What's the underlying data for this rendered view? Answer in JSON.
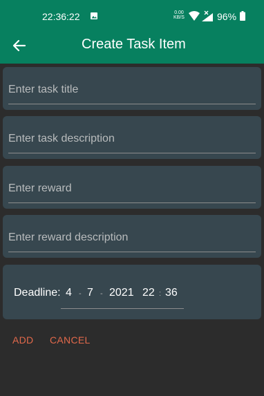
{
  "status_bar": {
    "time": "22:36:22",
    "speed_value": "0.00",
    "speed_unit": "KB/S",
    "battery": "96%"
  },
  "app_bar": {
    "title": "Create Task Item",
    "back_icon": "arrow-left-icon"
  },
  "form": {
    "title_placeholder": "Enter task title",
    "description_placeholder": "Enter task description",
    "reward_placeholder": "Enter reward",
    "reward_description_placeholder": "Enter reward description"
  },
  "deadline": {
    "label": "Deadline:",
    "day": "4",
    "month": "7",
    "year": "2021",
    "hour": "22",
    "minute": "36",
    "date_separator": "-",
    "time_separator": ":"
  },
  "actions": {
    "add_label": "ADD",
    "cancel_label": "CANCEL"
  },
  "colors": {
    "app_bar": "#07805f",
    "background": "#2c2c2c",
    "card": "#37474f",
    "accent": "#e2694b"
  }
}
